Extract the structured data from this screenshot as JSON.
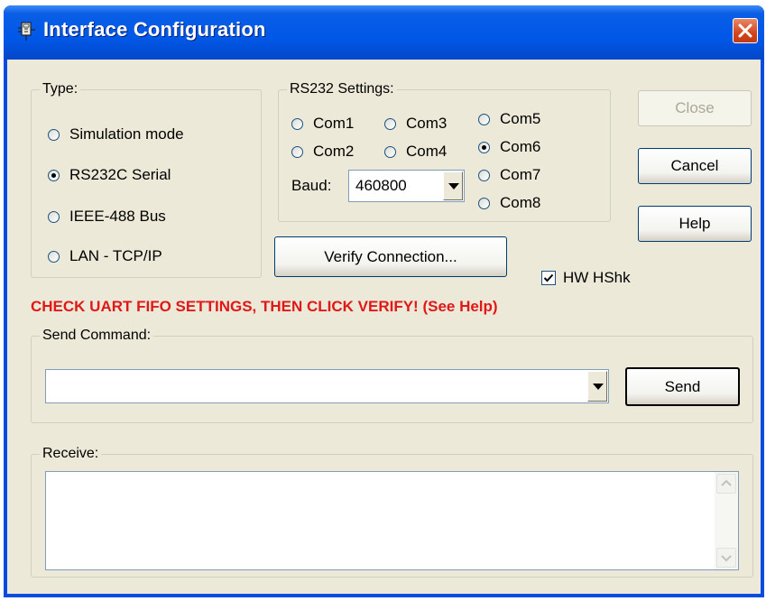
{
  "window": {
    "title": "Interface Configuration"
  },
  "type_group": {
    "legend": "Type:",
    "options": [
      {
        "label": "Simulation mode",
        "selected": false
      },
      {
        "label": "RS232C Serial",
        "selected": true
      },
      {
        "label": "IEEE-488 Bus",
        "selected": false
      },
      {
        "label": "LAN - TCP/IP",
        "selected": false
      }
    ]
  },
  "rs232_group": {
    "legend": "RS232 Settings:",
    "ports": [
      {
        "label": "Com1",
        "selected": false
      },
      {
        "label": "Com2",
        "selected": false
      },
      {
        "label": "Com3",
        "selected": false
      },
      {
        "label": "Com4",
        "selected": false
      },
      {
        "label": "Com5",
        "selected": false
      },
      {
        "label": "Com6",
        "selected": true
      },
      {
        "label": "Com7",
        "selected": false
      },
      {
        "label": "Com8",
        "selected": false
      }
    ],
    "baud_label": "Baud:",
    "baud_value": "460800"
  },
  "buttons": {
    "close": "Close",
    "cancel": "Cancel",
    "help": "Help",
    "verify": "Verify Connection...",
    "send": "Send"
  },
  "hw_handshake": {
    "label": "HW HShk",
    "checked": true
  },
  "warning": {
    "text": "CHECK UART FIFO SETTINGS, THEN CLICK VERIFY! (See Help)",
    "color": "#e01818"
  },
  "send_group": {
    "legend": "Send Command:",
    "value": ""
  },
  "receive_group": {
    "legend": "Receive:",
    "value": ""
  },
  "colors": {
    "titlebar": "#0058e8",
    "dialog_bg": "#ece9d8"
  }
}
